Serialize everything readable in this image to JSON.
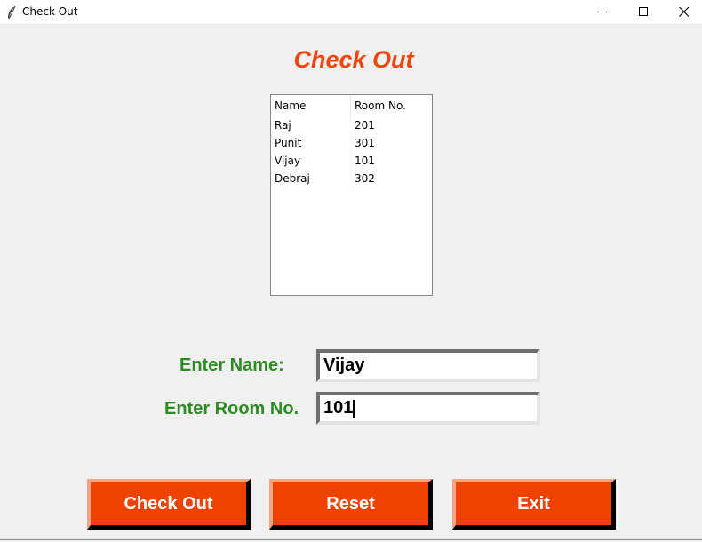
{
  "window": {
    "title": "Check Out",
    "app_icon": "feather-icon",
    "controls": {
      "minimize": "minimize-icon",
      "maximize": "maximize-icon",
      "close": "close-icon"
    }
  },
  "heading": "Check Out",
  "table": {
    "columns": [
      "Name",
      "Room No."
    ],
    "rows": [
      {
        "name": "Raj",
        "room": "201"
      },
      {
        "name": "Punit",
        "room": "301"
      },
      {
        "name": "Vijay",
        "room": "101"
      },
      {
        "name": "Debraj",
        "room": "302"
      }
    ]
  },
  "form": {
    "name_label": "Enter Name:",
    "name_value": "Vijay",
    "room_label": "Enter Room No.",
    "room_value": "101"
  },
  "buttons": {
    "checkout": "Check Out",
    "reset": "Reset",
    "exit": "Exit"
  },
  "colors": {
    "heading": "#ee4611",
    "label": "#2d8b23",
    "button": "#ee4300"
  }
}
